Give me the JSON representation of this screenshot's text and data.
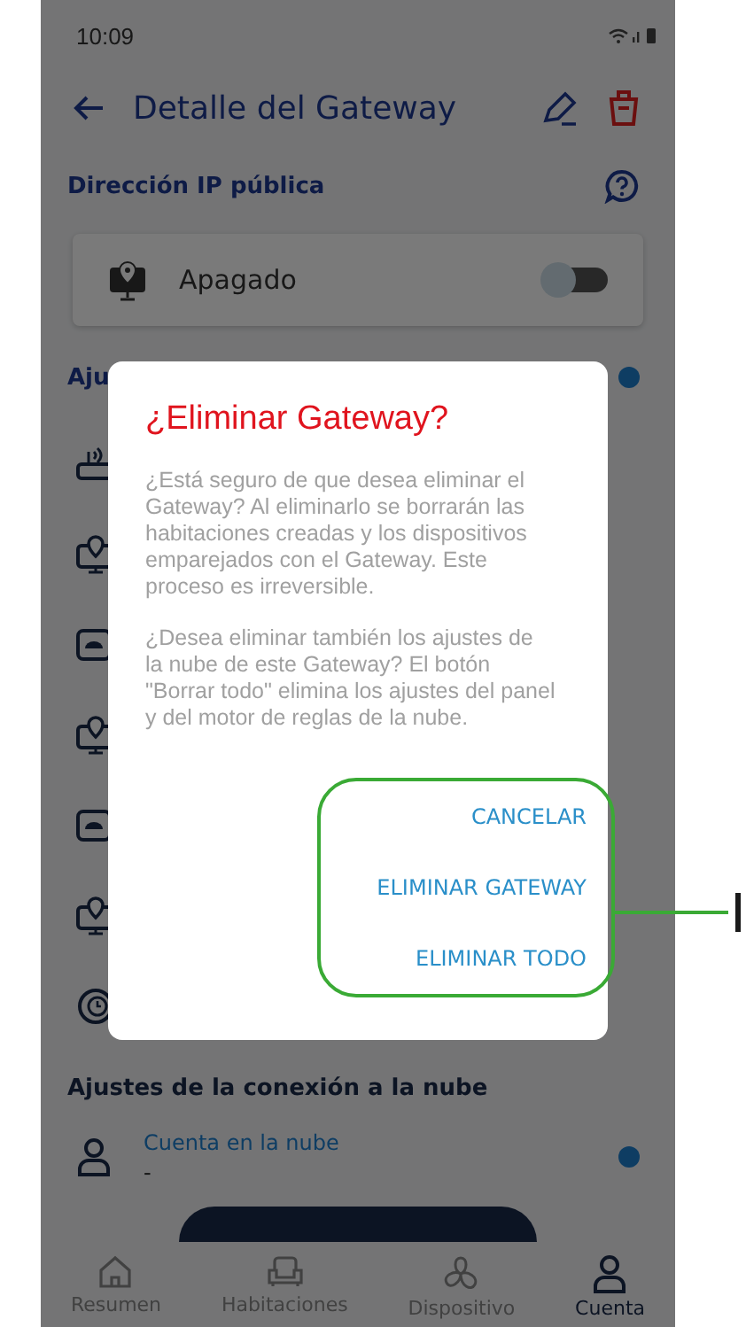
{
  "status_bar": {
    "time": "10:09"
  },
  "header": {
    "title": "Detalle del Gateway"
  },
  "ip_section": {
    "title": "Dirección IP pública",
    "card": {
      "label": "Apagado",
      "on": false
    }
  },
  "settings_section": {
    "title": "Aju",
    "rows": [
      {
        "kind": "router"
      },
      {
        "kind": "location"
      },
      {
        "kind": "panel"
      },
      {
        "kind": "location"
      },
      {
        "kind": "panel"
      },
      {
        "kind": "location"
      },
      {
        "kind": "clock"
      }
    ]
  },
  "cloud_section": {
    "title": "Ajustes de la conexión a la nube",
    "account": {
      "label": "Cuenta en la nube",
      "value": "-"
    }
  },
  "nav": [
    {
      "label": "Resumen",
      "kind": "home",
      "selected": false
    },
    {
      "label": "Habitaciones",
      "kind": "sofa",
      "selected": false
    },
    {
      "label": "Dispositivo",
      "kind": "fan",
      "selected": false
    },
    {
      "label": "Cuenta",
      "kind": "user",
      "selected": true
    }
  ],
  "dialog": {
    "title": "¿Eliminar Gateway?",
    "paragraphs": [
      "¿Está seguro de que desea eliminar el Gateway? Al eliminarlo se borrarán las habitaciones creadas y los dispositivos emparejados con el Gateway. Este proceso es irreversible.",
      "¿Desea eliminar también los ajustes de la nube de este Gateway? El botón \"Borrar todo\" elimina los ajustes del panel y del motor de reglas de la nube."
    ],
    "buttons": [
      "CANCELAR",
      "ELIMINAR GATEWAY",
      "ELIMINAR TODO"
    ]
  }
}
